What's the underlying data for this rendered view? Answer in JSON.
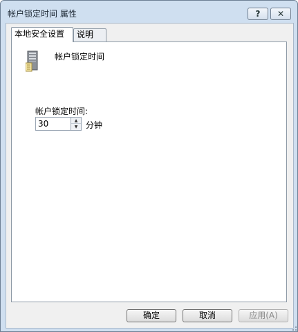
{
  "window": {
    "title": "帐户锁定时间 属性"
  },
  "titlebar": {
    "help_glyph": "?",
    "close_glyph": "✕"
  },
  "tabs": [
    {
      "label": "本地安全设置",
      "active": true
    },
    {
      "label": "说明",
      "active": false
    }
  ],
  "policy": {
    "icon": "server-computer-icon",
    "title": "帐户锁定时间"
  },
  "setting": {
    "label": "帐户锁定时间:",
    "value": "30",
    "unit": "分钟",
    "spin_up": "▲",
    "spin_down": "▼"
  },
  "buttons": {
    "ok": "确定",
    "cancel": "取消",
    "apply": "应用(A)"
  }
}
